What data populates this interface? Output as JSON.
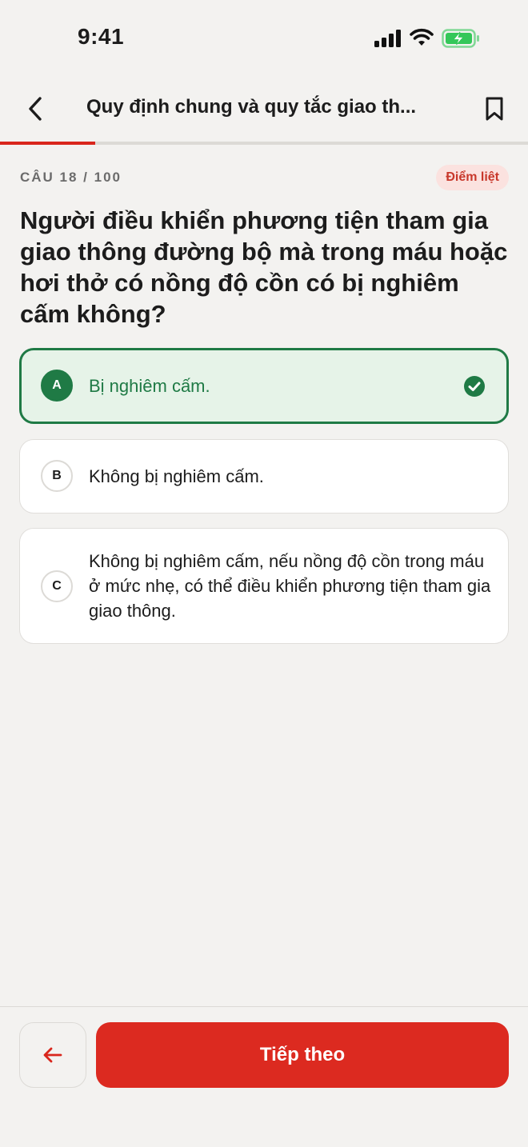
{
  "status_bar": {
    "time": "9:41"
  },
  "header": {
    "title": "Quy định chung và quy tắc giao th...",
    "back_icon": "chevron-left-icon",
    "bookmark_icon": "bookmark-icon"
  },
  "progress": {
    "fraction": 0.18,
    "color": "#d9261c"
  },
  "question": {
    "counter": "CÂU 18 / 100",
    "badge": "Điểm liệt",
    "text": "Người điều khiển phương tiện tham gia giao thông đường bộ mà trong máu hoặc hơi thở có nồng độ cồn có bị nghiêm cấm không?"
  },
  "options": [
    {
      "letter": "A",
      "text": "Bị nghiêm cấm.",
      "state": "correct"
    },
    {
      "letter": "B",
      "text": "Không bị nghiêm cấm.",
      "state": "default"
    },
    {
      "letter": "C",
      "text": "Không bị nghiêm cấm, nếu nồng độ cồn trong máu ở mức nhẹ, có thể điều khiển phương tiện tham gia giao thông.",
      "state": "default"
    }
  ],
  "footer": {
    "prev_icon": "arrow-left-icon",
    "next_label": "Tiếp theo"
  },
  "colors": {
    "accent": "#dc2a20",
    "correct": "#1f7a45",
    "correct_bg": "#e6f3e8"
  }
}
